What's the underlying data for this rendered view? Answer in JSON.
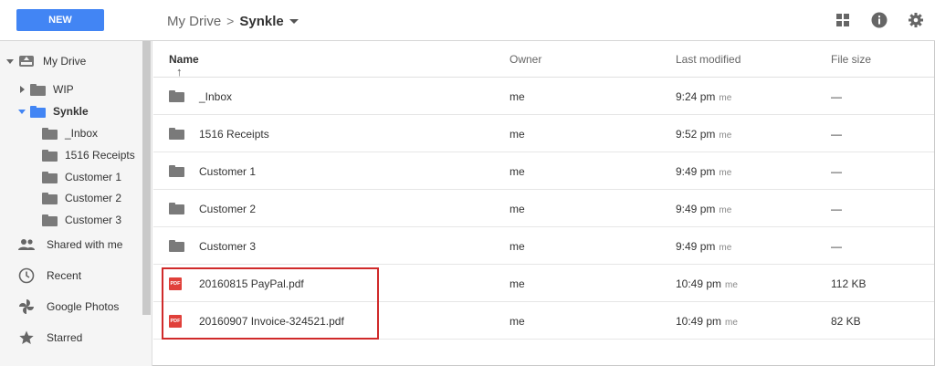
{
  "header": {
    "new_label": "NEW",
    "breadcrumb_root": "My Drive",
    "breadcrumb_sep": ">",
    "breadcrumb_current": "Synkle",
    "icons": [
      "grid-view-icon",
      "info-icon",
      "settings-icon"
    ]
  },
  "sidebar": {
    "my_drive": "My Drive",
    "folders": [
      {
        "label": "WIP",
        "expanded": false
      },
      {
        "label": "Synkle",
        "expanded": true,
        "selected": true
      }
    ],
    "subfolders": [
      "_Inbox",
      "1516 Receipts",
      "Customer 1",
      "Customer 2",
      "Customer 3"
    ],
    "nav": [
      "Shared with me",
      "Recent",
      "Google Photos",
      "Starred"
    ]
  },
  "list": {
    "columns": {
      "name": "Name",
      "owner": "Owner",
      "modified": "Last modified",
      "size": "File size"
    },
    "rows": [
      {
        "type": "folder",
        "name": "_Inbox",
        "owner": "me",
        "time": "9:24 pm",
        "by": "me",
        "size": "—"
      },
      {
        "type": "folder",
        "name": "1516 Receipts",
        "owner": "me",
        "time": "9:52 pm",
        "by": "me",
        "size": "—"
      },
      {
        "type": "folder",
        "name": "Customer 1",
        "owner": "me",
        "time": "9:49 pm",
        "by": "me",
        "size": "—"
      },
      {
        "type": "folder",
        "name": "Customer 2",
        "owner": "me",
        "time": "9:49 pm",
        "by": "me",
        "size": "—"
      },
      {
        "type": "folder",
        "name": "Customer 3",
        "owner": "me",
        "time": "9:49 pm",
        "by": "me",
        "size": "—"
      },
      {
        "type": "pdf",
        "name": "20160815 PayPal.pdf",
        "owner": "me",
        "time": "10:49 pm",
        "by": "me",
        "size": "112 KB"
      },
      {
        "type": "pdf",
        "name": "20160907 Invoice-324521.pdf",
        "owner": "me",
        "time": "10:49 pm",
        "by": "me",
        "size": "82 KB"
      }
    ],
    "pdf_badge": "PDF"
  },
  "colors": {
    "accent": "#4285f4",
    "highlight": "#d02a2a",
    "pdf": "#e0403a"
  }
}
